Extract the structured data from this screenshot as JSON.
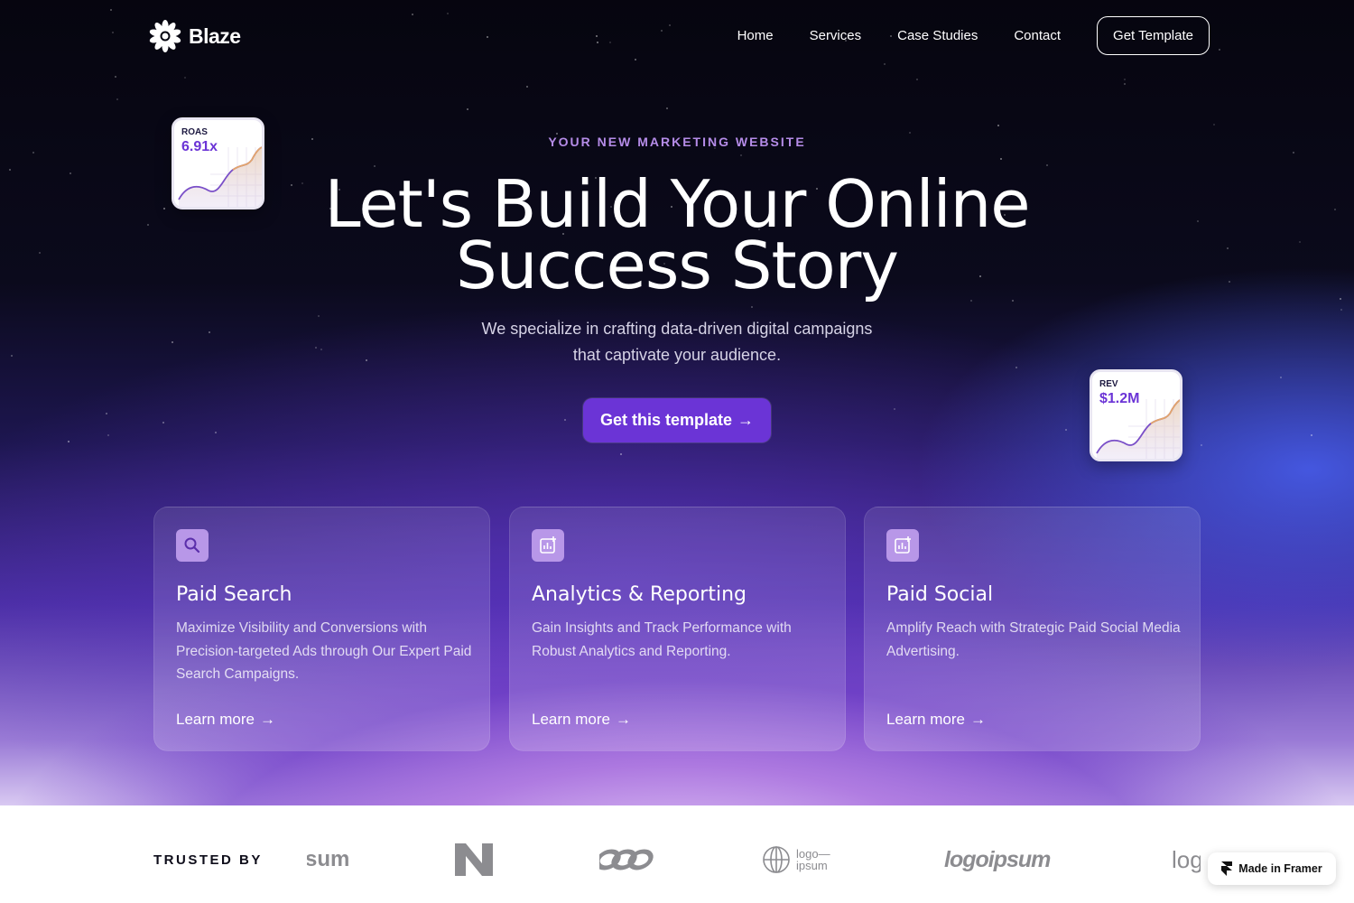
{
  "brand": {
    "name": "Blaze",
    "logo_icon": "flower-burst-icon"
  },
  "nav": {
    "links": [
      "Home",
      "Services",
      "Case Studies",
      "Contact"
    ],
    "cta": "Get Template"
  },
  "hero": {
    "eyebrow": "YOUR NEW MARKETING WEBSITE",
    "headline_line1": "Let's Build Your Online",
    "headline_line2": "Success Story",
    "subtitle_line1": "We specialize in crafting data-driven digital campaigns",
    "subtitle_line2": "that captivate your audience.",
    "cta": "Get this template",
    "cta_arrow": "→"
  },
  "stats": [
    {
      "label": "ROAS",
      "value": "6.91x"
    },
    {
      "label": "REV",
      "value": "$1.2M"
    }
  ],
  "services": [
    {
      "icon": "search-icon",
      "title": "Paid Search",
      "description": "Maximize Visibility and Conversions with Precision-targeted Ads through Our Expert Paid Search Campaigns.",
      "link": "Learn more"
    },
    {
      "icon": "chart-plus-icon",
      "title": "Analytics & Reporting",
      "description": "Gain Insights and Track Performance with Robust Analytics and Reporting.",
      "link": "Learn more"
    },
    {
      "icon": "chart-plus-icon",
      "title": "Paid Social",
      "description": "Amplify Reach with Strategic Paid Social Media Advertising.",
      "link": "Learn more"
    }
  ],
  "trusted": {
    "label": "TRUSTED BY",
    "logos": [
      "sum",
      "N",
      "co-infinity",
      "logo— ipsum",
      "logoipsum",
      "log"
    ]
  },
  "badge": {
    "label": "Made in Framer"
  },
  "colors": {
    "accent": "#6b34d6",
    "eyebrow": "#b58ce8",
    "card_icon_bg": "#b897e8"
  }
}
